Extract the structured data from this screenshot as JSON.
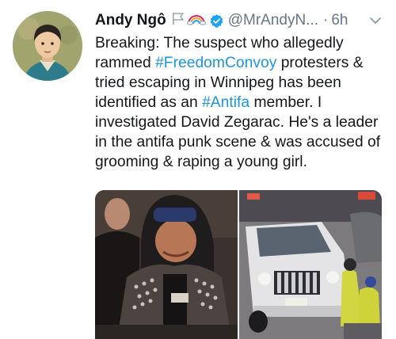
{
  "tweet": {
    "display_name": "Andy Ngô",
    "handle": "@MrAndyN...",
    "separator": "·",
    "time": "6h",
    "text_before_1": "Breaking: The suspect who allegedly rammed ",
    "hashtag_1": "#FreedomConvoy",
    "text_between": " protesters & tried escaping in Winnipeg has been identified as an ",
    "hashtag_2": "#Antifa",
    "text_after": " member. I investigated David Zegarac. He's a leader in the antifa punk scene & was accused of grooming & raping a young girl."
  },
  "icons": {
    "flag": "white-flag-icon",
    "rainbow": "rainbow-icon",
    "verified": "verified-badge-icon",
    "more": "chevron-down-icon"
  },
  "colors": {
    "text": "#14171a",
    "secondary": "#657786",
    "link": "#1b95e0",
    "verified": "#1da1f2"
  }
}
